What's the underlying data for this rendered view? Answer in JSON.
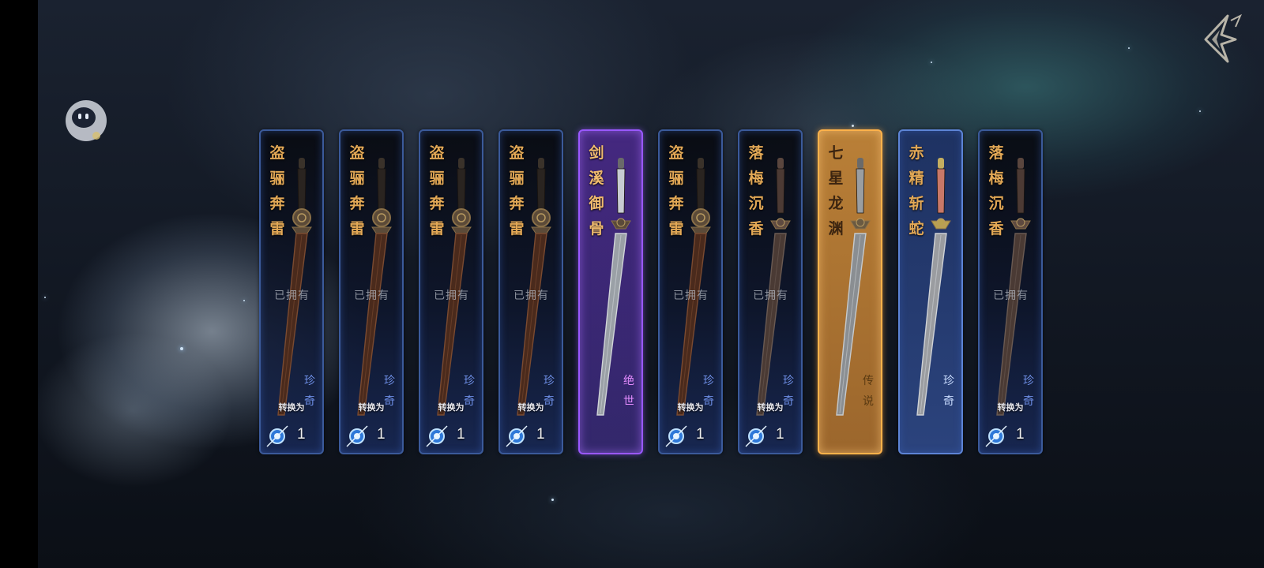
{
  "header": {
    "close_icon": "diamond-return-icon",
    "helper_icon": "robot-helper-icon"
  },
  "labels": {
    "owned": "已拥有",
    "convert": "转换为"
  },
  "cards": [
    {
      "name": "盗骊奔雷",
      "rarity": "珍奇",
      "owned": true,
      "count": "1",
      "style": "rare"
    },
    {
      "name": "盗骊奔雷",
      "rarity": "珍奇",
      "owned": true,
      "count": "1",
      "style": "rare"
    },
    {
      "name": "盗骊奔雷",
      "rarity": "珍奇",
      "owned": true,
      "count": "1",
      "style": "rare"
    },
    {
      "name": "盗骊奔雷",
      "rarity": "珍奇",
      "owned": true,
      "count": "1",
      "style": "rare"
    },
    {
      "name": "剑溪御骨",
      "rarity": "绝世",
      "owned": false,
      "count": "",
      "style": "peerless"
    },
    {
      "name": "盗骊奔雷",
      "rarity": "珍奇",
      "owned": true,
      "count": "1",
      "style": "rare"
    },
    {
      "name": "落梅沉香",
      "rarity": "珍奇",
      "owned": true,
      "count": "1",
      "style": "rare"
    },
    {
      "name": "七星龙渊",
      "rarity": "传说",
      "owned": false,
      "count": "",
      "style": "legend"
    },
    {
      "name": "赤精斩蛇",
      "rarity": "珍奇",
      "owned": false,
      "count": "",
      "style": "rare-selected"
    },
    {
      "name": "落梅沉香",
      "rarity": "珍奇",
      "owned": true,
      "count": "1",
      "style": "rare"
    }
  ],
  "colors": {
    "rare_border": "#3b5a9a",
    "peerless_border": "#9a58ff",
    "legend_border": "#ffb24a",
    "name_gold": "#e2a856"
  }
}
